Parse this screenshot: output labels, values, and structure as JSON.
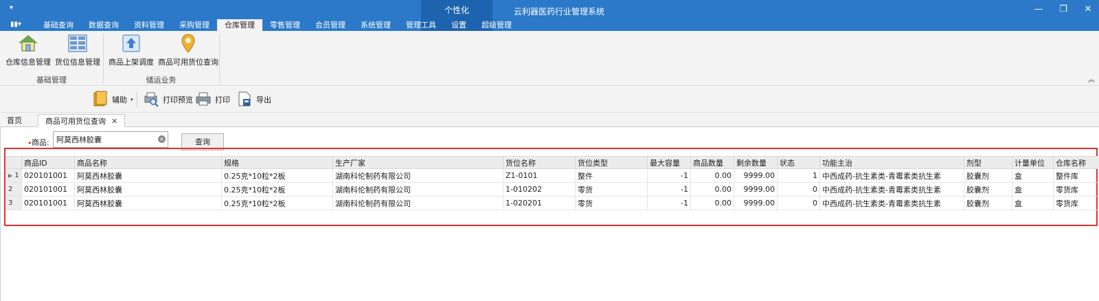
{
  "titlebar": {
    "quick": "▾",
    "context_group": "个性化",
    "app_title": "云利器医药行业管理系统",
    "minimize": "—",
    "restore": "❐",
    "close": "✕",
    "app_menu": "▮▮▾"
  },
  "tabs": [
    {
      "label": "基础查询"
    },
    {
      "label": "数据查询"
    },
    {
      "label": "资料管理"
    },
    {
      "label": "采购管理"
    },
    {
      "label": "仓库管理"
    },
    {
      "label": "零售管理"
    },
    {
      "label": "会员管理"
    },
    {
      "label": "系统管理"
    },
    {
      "label": "管理工具"
    },
    {
      "label": "设置"
    },
    {
      "label": "超级管理"
    }
  ],
  "ribbon": {
    "items": [
      {
        "label": "仓库信息管理",
        "icon": "warehouse-icon"
      },
      {
        "label": "货位信息管理",
        "icon": "grid-icon"
      },
      {
        "label": "商品上架调度",
        "icon": "upload-icon"
      },
      {
        "label": "商品可用货位查询",
        "icon": "location-pin-icon"
      }
    ],
    "groups": [
      {
        "label": "基础管理"
      },
      {
        "label": "储运业务"
      }
    ],
    "collapse": "︽"
  },
  "toolbar": {
    "assist": "辅助",
    "print_preview": "打印预览",
    "print": "打印",
    "export": "导出"
  },
  "doctabs": {
    "home": "首页",
    "active": "商品可用货位查询",
    "close": "✕"
  },
  "search": {
    "required_mark": "•",
    "label": "商品:",
    "value": "阿莫西林胶囊",
    "clear": "×",
    "query_button": "查询"
  },
  "grid": {
    "columns": [
      "商品ID",
      "商品名称",
      "规格",
      "生产厂家",
      "货位名称",
      "货位类型",
      "最大容量",
      "商品数量",
      "剩余数量",
      "状态",
      "功能主治",
      "剂型",
      "计量单位",
      "仓库名称"
    ],
    "rows": [
      {
        "no": "1",
        "cells": [
          "020101001",
          "阿莫西林胶囊",
          "0.25克*10粒*2板",
          "湖南科伦制药有限公司",
          "Z1-0101",
          "整件",
          "-1",
          "0.00",
          "9999.00",
          "1",
          "中西成药-抗生素类-青霉素类抗生素",
          "胶囊剂",
          "盒",
          "整件库"
        ]
      },
      {
        "no": "2",
        "cells": [
          "020101001",
          "阿莫西林胶囊",
          "0.25克*10粒*2板",
          "湖南科伦制药有限公司",
          "1-010202",
          "零货",
          "-1",
          "0.00",
          "9999.00",
          "0",
          "中西成药-抗生素类-青霉素类抗生素",
          "胶囊剂",
          "盒",
          "零货库"
        ]
      },
      {
        "no": "3",
        "cells": [
          "020101001",
          "阿莫西林胶囊",
          "0.25克*10粒*2板",
          "湖南科伦制药有限公司",
          "1-020201",
          "零货",
          "-1",
          "0.00",
          "9999.00",
          "0",
          "中西成药-抗生素类-青霉素类抗生素",
          "胶囊剂",
          "盒",
          "零货库"
        ]
      }
    ]
  }
}
